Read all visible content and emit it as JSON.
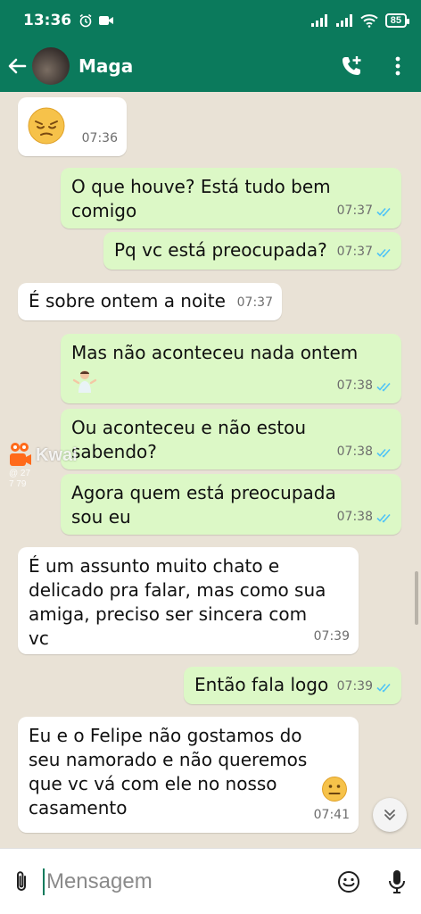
{
  "status_bar": {
    "time": "13:36",
    "battery": "85"
  },
  "header": {
    "contact_name": "Maga"
  },
  "messages": [
    {
      "text": "",
      "time": "07:36"
    },
    {
      "text": "O que houve? Está tudo bem comigo",
      "time": "07:37"
    },
    {
      "text": "Pq vc está preocupada?",
      "time": "07:37"
    },
    {
      "text": "É sobre ontem a noite",
      "time": "07:37"
    },
    {
      "text": "Mas não aconteceu nada ontem",
      "time": "07:38"
    },
    {
      "text": "Ou aconteceu e não estou sabendo?",
      "time": "07:38"
    },
    {
      "text": "Agora quem está preocupada sou eu",
      "time": "07:38"
    },
    {
      "text": "É um assunto muito chato e delicado pra falar, mas como sua amiga, preciso ser sincera com vc",
      "time": "07:39"
    },
    {
      "text": "Então fala logo",
      "time": "07:39"
    },
    {
      "text": "Eu e o Felipe não gostamos do seu namorado e não queremos que vc vá com ele no nosso casamento",
      "time": "07:41"
    }
  ],
  "watermark": {
    "brand": "Kwai",
    "line1": "@ 27",
    "line2": "7 79"
  },
  "composer": {
    "placeholder": "Mensagem"
  },
  "colors": {
    "header": "#0b7a5c",
    "outgoing_bubble": "#dcf8c6",
    "incoming_bubble": "#ffffff",
    "chat_background": "#e9e2d6",
    "read_ticks": "#4fc3f7"
  }
}
